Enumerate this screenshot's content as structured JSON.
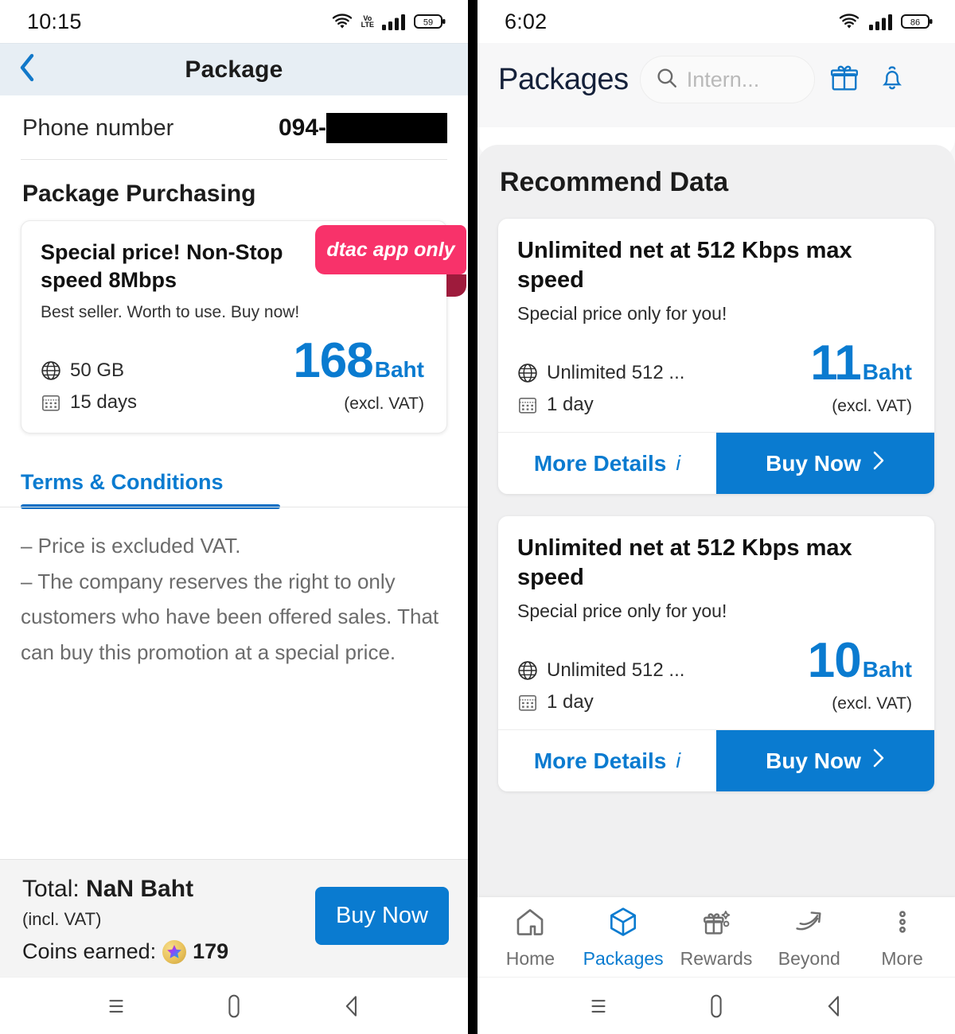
{
  "left": {
    "status": {
      "time": "10:15",
      "volte": "Vo\nLTE",
      "battery": "59"
    },
    "appbar": {
      "title": "Package",
      "back_icon": "chevron-left-icon"
    },
    "phone_row": {
      "label": "Phone number",
      "value": "094-",
      "redacted": true
    },
    "section_title": "Package Purchasing",
    "package": {
      "title": "Special price! Non-Stop speed 8Mbps",
      "subtitle": "Best seller. Worth to use. Buy now!",
      "badge": "dtac app only",
      "data_feature": "50 GB",
      "duration_feature": "15 days",
      "price": "168",
      "currency": "Baht",
      "vat_note": "(excl. VAT)"
    },
    "tab": {
      "label": "Terms & Conditions"
    },
    "terms": [
      "– Price is excluded VAT.",
      "– The company reserves the right to only customers who have been offered sales. That can buy this promotion at a special price."
    ],
    "total_bar": {
      "total_prefix": "Total: ",
      "total_value": "NaN Baht",
      "vat_note": "(incl. VAT)",
      "coins_label": "Coins earned: ",
      "coins_value": "179",
      "buy_label": "Buy Now"
    }
  },
  "right": {
    "status": {
      "time": "6:02",
      "battery": "86"
    },
    "header": {
      "title": "Packages",
      "search_placeholder": "Intern...",
      "gift_icon": "gift-icon",
      "bell_icon": "bell-icon"
    },
    "section_title": "Recommend Data",
    "cards": [
      {
        "title": "Unlimited net at 512 Kbps max speed",
        "subtitle": "Special price only for you!",
        "data_feature": "Unlimited 512 ...",
        "duration_feature": "1 day",
        "price": "11",
        "currency": "Baht",
        "vat_note": "(excl. VAT)",
        "details_label": "More Details",
        "buy_label": "Buy Now"
      },
      {
        "title": "Unlimited net at 512 Kbps max speed",
        "subtitle": "Special price only for you!",
        "data_feature": "Unlimited 512 ...",
        "duration_feature": "1 day",
        "price": "10",
        "currency": "Baht",
        "vat_note": "(excl. VAT)",
        "details_label": "More Details",
        "buy_label": "Buy Now"
      }
    ],
    "tabbar": [
      {
        "label": "Home",
        "icon": "home-icon",
        "active": false
      },
      {
        "label": "Packages",
        "icon": "cube-icon",
        "active": true
      },
      {
        "label": "Rewards",
        "icon": "gift-sparkle-icon",
        "active": false
      },
      {
        "label": "Beyond",
        "icon": "swoosh-arrow-icon",
        "active": false
      },
      {
        "label": "More",
        "icon": "dots-vertical-icon",
        "active": false
      }
    ]
  },
  "colors": {
    "accent": "#0a7bd0",
    "badge": "#f8326a",
    "badge_fold": "#9e1b3c",
    "appbar_bg": "#e7eef4"
  }
}
